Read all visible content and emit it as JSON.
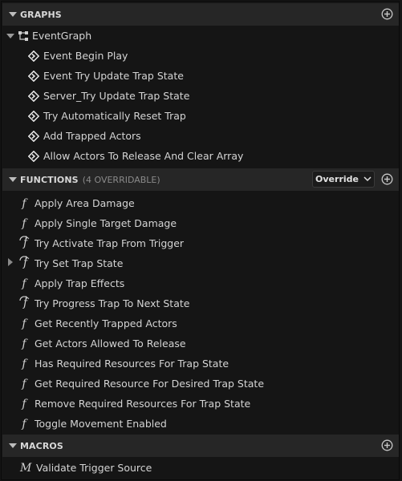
{
  "graphs": {
    "title": "GRAPHS",
    "event_graph": {
      "label": "EventGraph",
      "events": [
        "Event Begin Play",
        "Event Try Update Trap State",
        "Server_Try Update Trap State",
        "Try Automatically Reset Trap",
        "Add Trapped Actors",
        "Allow Actors To Release And Clear Array"
      ]
    }
  },
  "functions": {
    "title": "FUNCTIONS",
    "subtitle": "(4 OVERRIDABLE)",
    "override_label": "Override",
    "items": [
      {
        "label": "Apply Area Damage",
        "icon": "function-icon"
      },
      {
        "label": "Apply Single Target Damage",
        "icon": "function-icon"
      },
      {
        "label": "Try Activate Trap From Trigger",
        "icon": "override-function-icon"
      },
      {
        "label": "Try Set Trap State",
        "icon": "override-function-icon"
      },
      {
        "label": "Apply Trap Effects",
        "icon": "function-icon"
      },
      {
        "label": "Try Progress Trap To Next State",
        "icon": "override-function-icon"
      },
      {
        "label": "Get Recently Trapped Actors",
        "icon": "function-icon"
      },
      {
        "label": "Get Actors Allowed To Release",
        "icon": "function-icon"
      },
      {
        "label": "Has Required Resources For Trap State",
        "icon": "function-icon"
      },
      {
        "label": "Get Required Resource For Desired Trap State",
        "icon": "function-icon"
      },
      {
        "label": "Remove Required Resources For Trap State",
        "icon": "function-icon"
      },
      {
        "label": "Toggle Movement Enabled",
        "icon": "function-icon"
      }
    ]
  },
  "macros": {
    "title": "MACROS",
    "items": [
      {
        "label": "Validate Trigger Source",
        "icon": "macro-icon"
      }
    ]
  }
}
